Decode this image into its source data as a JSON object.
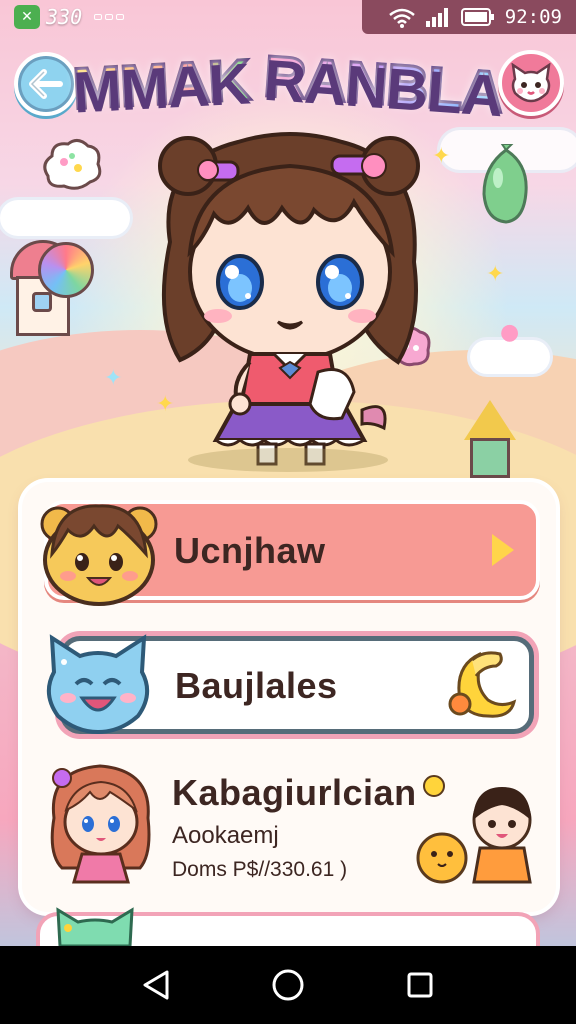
{
  "status_bar": {
    "app_badge": "✕",
    "notification_count": "330",
    "time": "92:09"
  },
  "header": {
    "title_word_1": "MMAK",
    "title_word_2": "RANBLA",
    "back_icon": "back-arrow-icon",
    "profile_icon": "cat-face-icon"
  },
  "menu": {
    "items": [
      {
        "label": "Ucnjhaw",
        "icon": "play-arrow-icon"
      },
      {
        "label": "Baujlales",
        "icon": "banana-icon"
      },
      {
        "label": "Kabagiurlcian",
        "subtitle": "Aookaemj",
        "detail": "Doms P$//330.61 )"
      },
      {
        "label": ""
      }
    ]
  },
  "colors": {
    "menu_item_active": "#f79a94",
    "menu_item_border": "#566c79",
    "accent_pink": "#f2a3b7",
    "back_button": "#8fd3ef",
    "profile_button": "#f07a9a"
  },
  "nav": {
    "back": "nav-back-icon",
    "home": "nav-home-icon",
    "recents": "nav-recents-icon"
  }
}
